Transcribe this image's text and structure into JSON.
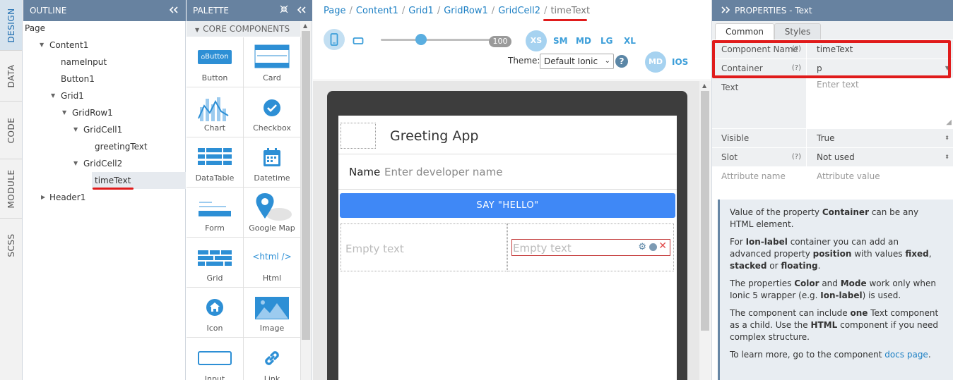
{
  "vtabs": [
    "DESIGN",
    "DATA",
    "CODE",
    "MODULE",
    "SCSS"
  ],
  "outline": {
    "title": "OUTLINE",
    "collapse_icon": "double-chevron-left",
    "tree": [
      "Page",
      "Content1",
      "nameInput",
      "Button1",
      "Grid1",
      "GridRow1",
      "GridCell1",
      "greetingText",
      "GridCell2",
      "timeText",
      "Header1"
    ],
    "selected": "timeText"
  },
  "palette": {
    "title": "PALETTE",
    "section": "CORE COMPONENTS",
    "items": [
      "Button",
      "Card",
      "Chart",
      "Checkbox",
      "DataTable",
      "Datetime",
      "Form",
      "Google Map",
      "Grid",
      "Html",
      "Icon",
      "Image",
      "Input",
      "Link"
    ],
    "button_icon_text": "Button",
    "html_icon_text": "<html />"
  },
  "breadcrumb": {
    "items": [
      "Page",
      "Content1",
      "Grid1",
      "GridRow1",
      "GridCell2"
    ],
    "current": "timeText"
  },
  "toolbar": {
    "zoom_value": "100",
    "breakpoints": [
      "XS",
      "SM",
      "MD",
      "LG",
      "XL"
    ],
    "active_breakpoint": "XS",
    "theme_label": "Theme:",
    "theme_value": "Default Ionic",
    "help": "?",
    "mode_md": "MD",
    "mode_ios": "IOS"
  },
  "preview": {
    "header_title": "Greeting App",
    "name_label": "Name",
    "name_placeholder": "Enter developer name",
    "button_label": "SAY \"HELLO\"",
    "cell1_text": "Empty text",
    "cell2_text": "Empty text"
  },
  "properties": {
    "title": "PROPERTIES - Text",
    "tabs": [
      "Common",
      "Styles"
    ],
    "rows": [
      {
        "key": "Component Name",
        "help": "(?)",
        "value": "timeText"
      },
      {
        "key": "Container",
        "help": "(?)",
        "value": "p"
      },
      {
        "key": "Text",
        "help": "",
        "value": "Enter text"
      },
      {
        "key": "Visible",
        "help": "",
        "value": "True"
      },
      {
        "key": "Slot",
        "help": "(?)",
        "value": "Not used"
      },
      {
        "key": "Attribute name",
        "help": "",
        "value": "Attribute value"
      }
    ],
    "info": {
      "p1_a": "Value of the property ",
      "p1_b": "Container",
      "p1_c": " can be any HTML element.",
      "p2_a": "For ",
      "p2_b": "Ion-label",
      "p2_c": " container you can add an advanced property ",
      "p2_d": "position",
      "p2_e": " with values ",
      "p2_f": "fixed",
      "p2_g": ", ",
      "p2_h": "stacked",
      "p2_i": " or ",
      "p2_j": "floating",
      "p2_k": ".",
      "p3_a": "The properties ",
      "p3_b": "Color",
      "p3_c": " and ",
      "p3_d": "Mode",
      "p3_e": " work only when Ionic 5 wrapper (e.g. ",
      "p3_f": "Ion-label",
      "p3_g": ") is used.",
      "p4_a": "The component can include ",
      "p4_b": "one",
      "p4_c": " Text component as a child. Use the ",
      "p4_d": "HTML",
      "p4_e": " component if you need complex structure.",
      "p5_a": "To learn more, go to the component ",
      "p5_link": "docs page",
      "p5_b": "."
    }
  },
  "colors": {
    "header_bg": "#6782a0",
    "accent_blue": "#1e80c4",
    "button_blue": "#3f88f6",
    "annotation_red": "#e01b1b"
  }
}
